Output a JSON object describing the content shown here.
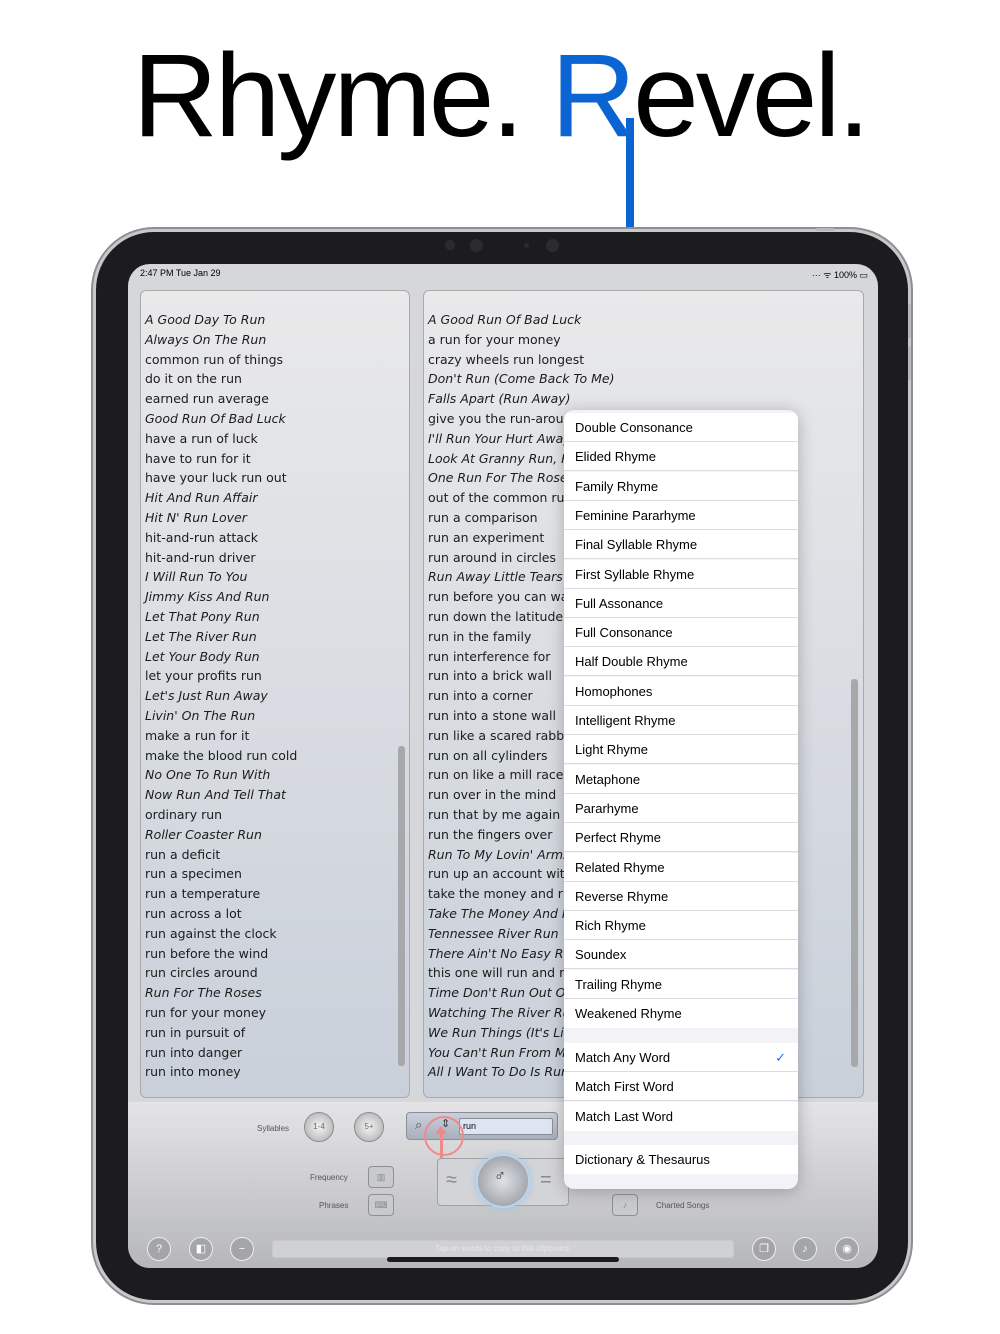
{
  "headline": {
    "part1": "Rhyme. ",
    "accent": "R",
    "part2": "evel."
  },
  "status": {
    "time": "2:47 PM   Tue Jan 29",
    "right": "··· ᯤ 100% ▭"
  },
  "left_list": [
    {
      "t": "A Good Day To Run",
      "i": true
    },
    {
      "t": "Always On The Run",
      "i": true
    },
    {
      "t": "common run of things",
      "i": false
    },
    {
      "t": "do it on the run",
      "i": false
    },
    {
      "t": "earned run average",
      "i": false
    },
    {
      "t": "Good Run Of Bad Luck",
      "i": true
    },
    {
      "t": "have a run of luck",
      "i": false
    },
    {
      "t": "have to run for it",
      "i": false
    },
    {
      "t": "have your luck run out",
      "i": false
    },
    {
      "t": "Hit And Run Affair",
      "i": true
    },
    {
      "t": "Hit N' Run Lover",
      "i": true
    },
    {
      "t": "hit-and-run attack",
      "i": false
    },
    {
      "t": "hit-and-run driver",
      "i": false
    },
    {
      "t": "I Will Run To You",
      "i": true
    },
    {
      "t": "Jimmy Kiss And Run",
      "i": true
    },
    {
      "t": "Let That Pony Run",
      "i": true
    },
    {
      "t": "Let The River Run",
      "i": true
    },
    {
      "t": "Let Your Body Run",
      "i": true
    },
    {
      "t": "let your profits run",
      "i": false
    },
    {
      "t": "Let's Just Run Away",
      "i": true
    },
    {
      "t": "Livin' On The Run",
      "i": true
    },
    {
      "t": "make a run for it",
      "i": false
    },
    {
      "t": "make the blood run cold",
      "i": false
    },
    {
      "t": "No One To Run With",
      "i": true
    },
    {
      "t": "Now Run And Tell That",
      "i": true
    },
    {
      "t": "ordinary run",
      "i": false
    },
    {
      "t": "Roller Coaster Run",
      "i": true
    },
    {
      "t": "run a deficit",
      "i": false
    },
    {
      "t": "run a specimen",
      "i": false
    },
    {
      "t": "run a temperature",
      "i": false
    },
    {
      "t": "run across a lot",
      "i": false
    },
    {
      "t": "run against the clock",
      "i": false
    },
    {
      "t": "run before the wind",
      "i": false
    },
    {
      "t": "run circles around",
      "i": false
    },
    {
      "t": "Run For The Roses",
      "i": true
    },
    {
      "t": "run for your money",
      "i": false
    },
    {
      "t": "run in pursuit of",
      "i": false
    },
    {
      "t": "run into danger",
      "i": false
    },
    {
      "t": "run into money",
      "i": false
    }
  ],
  "right_list": [
    {
      "t": "A Good Run Of Bad Luck",
      "i": true
    },
    {
      "t": "a run for your money",
      "i": false
    },
    {
      "t": "crazy wheels run longest",
      "i": false
    },
    {
      "t": "Don't Run (Come Back To Me)",
      "i": true
    },
    {
      "t": "Falls Apart (Run Away)",
      "i": true
    },
    {
      "t": "give you the run-aroun",
      "i": false
    },
    {
      "t": "I'll Run Your Hurt Away",
      "i": true
    },
    {
      "t": "Look At Granny Run, R",
      "i": true
    },
    {
      "t": "One Run For The Roses",
      "i": true
    },
    {
      "t": "out of the common run",
      "i": false
    },
    {
      "t": "run a comparison",
      "i": false
    },
    {
      "t": "run an experiment",
      "i": false
    },
    {
      "t": "run around in circles",
      "i": false
    },
    {
      "t": "Run Away Little Tears",
      "i": true
    },
    {
      "t": "run before you can wal",
      "i": false
    },
    {
      "t": "run down the latitude",
      "i": false
    },
    {
      "t": "run in the family",
      "i": false
    },
    {
      "t": "run interference for",
      "i": false
    },
    {
      "t": "run into a brick wall",
      "i": false
    },
    {
      "t": "run into a corner",
      "i": false
    },
    {
      "t": "run into a stone wall",
      "i": false
    },
    {
      "t": "run like a scared rabbit",
      "i": false
    },
    {
      "t": "run on all cylinders",
      "i": false
    },
    {
      "t": "run on like a mill race",
      "i": false
    },
    {
      "t": "run over in the mind",
      "i": false
    },
    {
      "t": "run that by me again",
      "i": false
    },
    {
      "t": "run the fingers over",
      "i": false
    },
    {
      "t": "Run To My Lovin' Arms",
      "i": true
    },
    {
      "t": "run up an account with",
      "i": false
    },
    {
      "t": "take the money and ru",
      "i": false
    },
    {
      "t": "Take The Money And R",
      "i": true
    },
    {
      "t": "Tennessee River Run",
      "i": true
    },
    {
      "t": "There Ain't No Easy Ru",
      "i": true
    },
    {
      "t": "this one will run and ru",
      "i": false
    },
    {
      "t": "Time Don't Run Out On",
      "i": true
    },
    {
      "t": "Watching The River Ru",
      "i": true
    },
    {
      "t": "We Run Things (It's Lik",
      "i": true
    },
    {
      "t": "You Can't Run From My",
      "i": true
    },
    {
      "t": "All I Want To Do Is Rur",
      "i": true
    }
  ],
  "controls": {
    "syllables_label": "Syllables",
    "syll_btn1": "1-4",
    "syll_btn2": "5+",
    "search_value": "run",
    "frequency_label": "Frequency",
    "phrases_label": "Phrases",
    "charted_songs_label": "Charted Songs",
    "clipboard_placeholder": "Tap on words to copy to this clipboard."
  },
  "menu": {
    "rhyme_types": [
      "Double Consonance",
      "Elided Rhyme",
      "Family Rhyme",
      "Feminine Pararhyme",
      "Final Syllable Rhyme",
      "First Syllable Rhyme",
      "Full Assonance",
      "Full Consonance",
      "Half Double Rhyme",
      "Homophones",
      "Intelligent Rhyme",
      "Light Rhyme",
      "Metaphone",
      "Pararhyme",
      "Perfect Rhyme",
      "Related Rhyme",
      "Reverse Rhyme",
      "Rich Rhyme",
      "Soundex",
      "Trailing Rhyme",
      "Weakened Rhyme"
    ],
    "match_options": [
      "Match Any Word",
      "Match First Word",
      "Match Last Word"
    ],
    "selected_match": "Match Any Word",
    "check_glyph": "✓",
    "extra": "Dictionary & Thesaurus"
  },
  "colors": {
    "accent": "#0a64d2",
    "check": "#1a7aff"
  }
}
